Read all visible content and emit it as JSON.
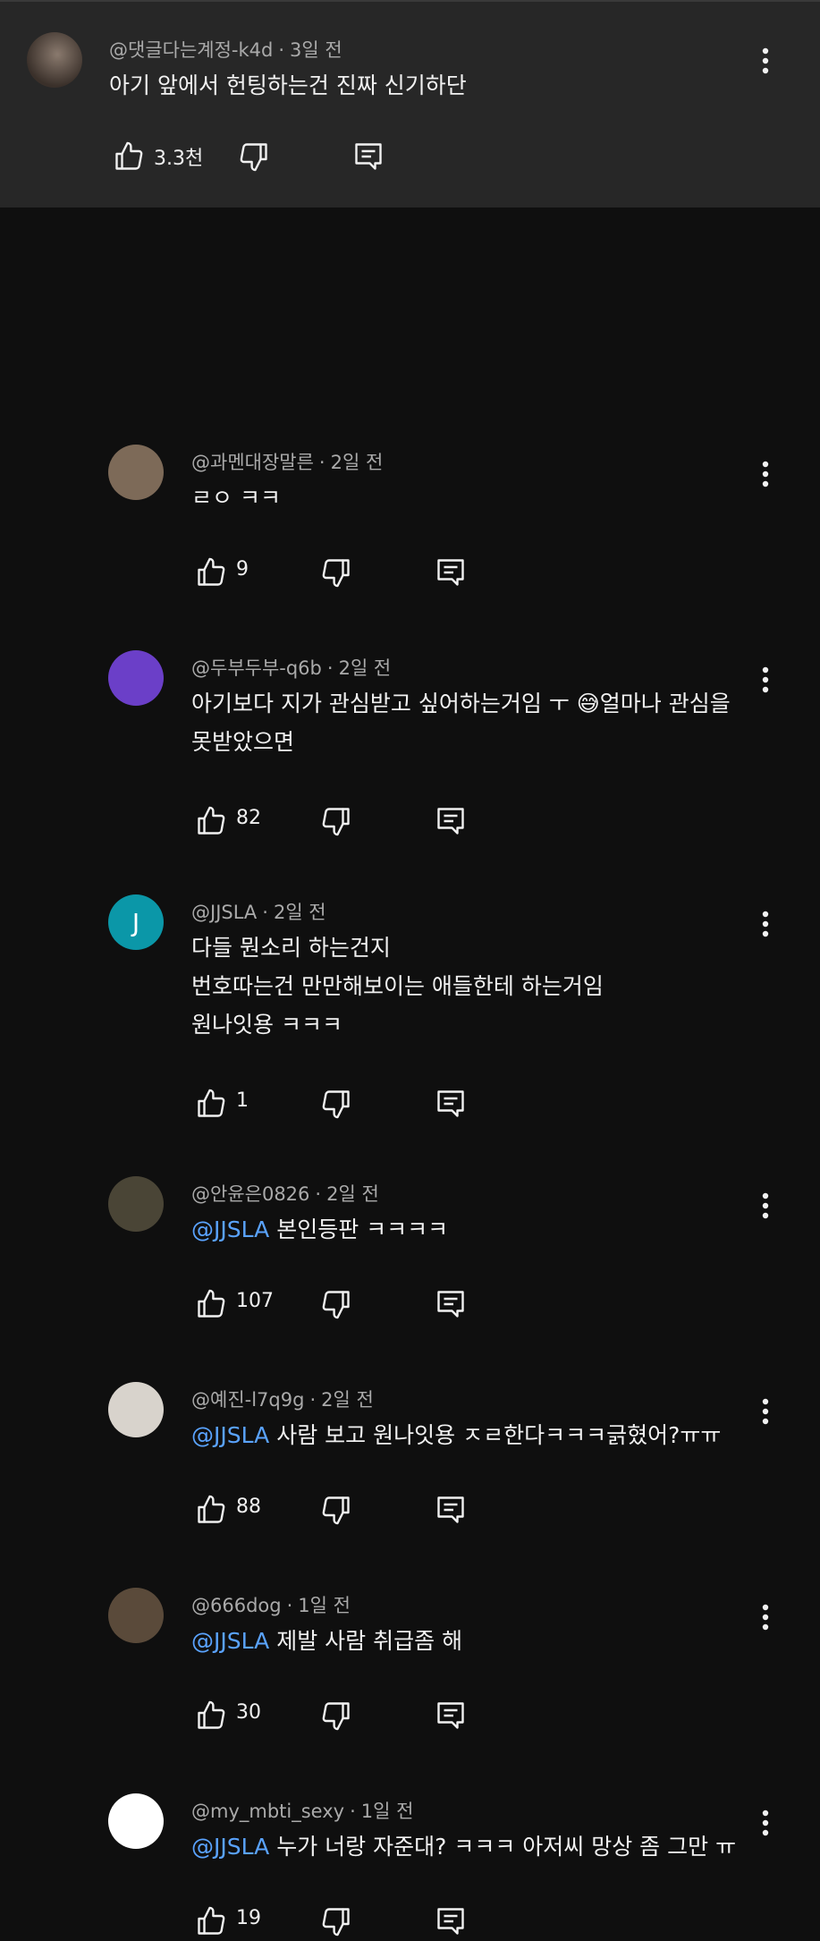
{
  "colors": {
    "background": "#0f0f0f",
    "parent_background": "#272727",
    "text": "#f1f1f1",
    "meta_text": "#aaaaaa",
    "mention": "#5aa3ff"
  },
  "icons": {
    "like": "thumbs-up-icon",
    "dislike": "thumbs-down-icon",
    "reply": "reply-icon",
    "more": "more-vert-icon"
  },
  "parent_comment": {
    "author": "@댓글다는계정-k4d",
    "time": "3일 전",
    "text": "아기 앞에서 헌팅하는건 진짜 신기하단",
    "likes": "3.3천"
  },
  "replies": [
    {
      "author": "@과멘대장말른",
      "time": "2일 전",
      "mention": "",
      "lines": [
        "ㄹㅇ ㅋㅋ"
      ],
      "likes": "9",
      "avatar_letter": "",
      "avatar_color": "#7d6a58"
    },
    {
      "author": "@두부두부-q6b",
      "time": "2일 전",
      "mention": "",
      "lines": [
        "아기보다 지가 관심받고 싶어하는거임 ㅜ 😅얼마나 관심을",
        "못받았으면"
      ],
      "likes": "82",
      "avatar_letter": "",
      "avatar_color": "#6b3fc8"
    },
    {
      "author": "@JJSLA",
      "time": "2일 전",
      "mention": "",
      "lines": [
        "다들 뭔소리 하는건지",
        "번호따는건 만만해보이는 애들한테 하는거임",
        "원나잇용 ㅋㅋㅋ"
      ],
      "likes": "1",
      "avatar_letter": "J",
      "avatar_color": "#0b97a8"
    },
    {
      "author": "@안윤은0826",
      "time": "2일 전",
      "mention": "@JJSLA",
      "lines": [
        "본인등판 ㅋㅋㅋㅋ"
      ],
      "likes": "107",
      "avatar_letter": "",
      "avatar_color": "#4a4536"
    },
    {
      "author": "@예진-l7q9g",
      "time": "2일 전",
      "mention": "@JJSLA",
      "lines": [
        "사람 보고 원나잇용 ㅈㄹ한다ㅋㅋㅋ긁혔어?ㅠㅠ"
      ],
      "likes": "88",
      "avatar_letter": "",
      "avatar_color": "#d8d3cc"
    },
    {
      "author": "@666dog",
      "time": "1일 전",
      "mention": "@JJSLA",
      "lines": [
        "제발 사람 취급좀 해"
      ],
      "likes": "30",
      "avatar_letter": "",
      "avatar_color": "#5a4a3a"
    },
    {
      "author": "@my_mbti_sexy",
      "time": "1일 전",
      "mention": "@JJSLA",
      "lines": [
        "누가 너랑 자준대? ㅋㅋㅋ 아저씨 망상 좀 그만 ㅠ"
      ],
      "likes": "19",
      "avatar_letter": "",
      "avatar_color": "#ffffff"
    }
  ]
}
